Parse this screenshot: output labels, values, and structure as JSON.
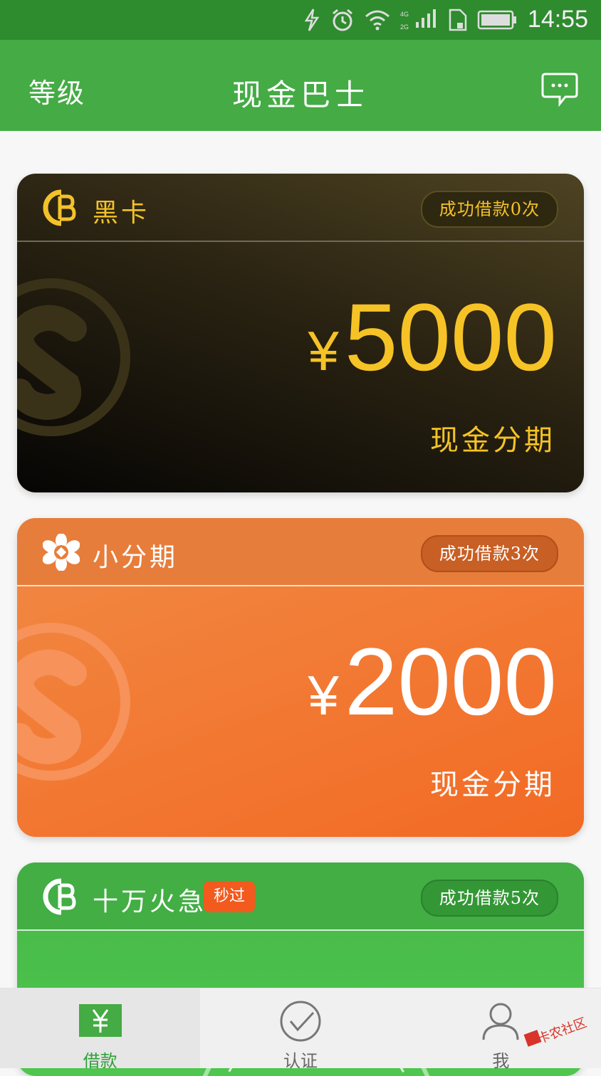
{
  "status_bar": {
    "time": "14:55",
    "icons": [
      "charging-icon",
      "alarm-icon",
      "wifi-icon",
      "signal-icon",
      "sim-icon",
      "battery-icon"
    ],
    "network_labels": [
      "4G",
      "2G"
    ]
  },
  "header": {
    "left_label": "等级",
    "title": "现金巴士",
    "right_icon": "message-icon"
  },
  "cards": [
    {
      "name": "黑卡",
      "badge": "成功借款0次",
      "currency": "¥",
      "amount": "5000",
      "subtitle": "现金分期",
      "icon": "cb-logo-icon",
      "colors": {
        "accent": "#f6c326",
        "background": "#1a1510"
      }
    },
    {
      "name": "小分期",
      "badge": "成功借款3次",
      "currency": "¥",
      "amount": "2000",
      "subtitle": "现金分期",
      "icon": "flower-logo-icon",
      "colors": {
        "accent": "#ffffff",
        "background": "#f27a34"
      }
    },
    {
      "name": "十万火急",
      "tag": "秒过",
      "badge": "成功借款5次",
      "icon": "cb-logo-icon",
      "colors": {
        "accent": "#f25a1e",
        "background": "#46b748"
      }
    }
  ],
  "tabs": [
    {
      "label": "借款",
      "icon": "yen-icon",
      "active": true
    },
    {
      "label": "认证",
      "icon": "check-circle-icon",
      "active": false
    },
    {
      "label": "我",
      "icon": "user-icon",
      "active": false
    }
  ],
  "watermark": "卡农社区"
}
